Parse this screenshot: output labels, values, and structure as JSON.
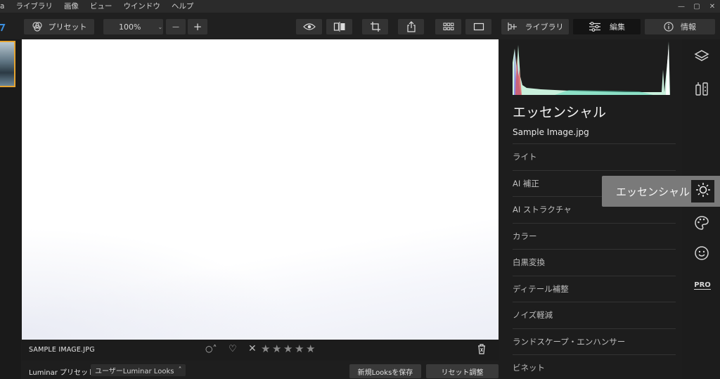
{
  "menubar": {
    "items": [
      "a",
      "ライブラリ",
      "画像",
      "ビュー",
      "ウインドウ",
      "ヘルプ"
    ],
    "window_controls": [
      "—",
      "▢",
      "✕"
    ]
  },
  "toolbar": {
    "preset_label": "プリセット",
    "zoom_value": "100%",
    "zoom_minus": "—",
    "zoom_plus": "+",
    "library_label": "ライブラリ",
    "edit_label": "編集",
    "info_label": "情報"
  },
  "infobar": {
    "filename": "SAMPLE IMAGE.JPG",
    "flag": "○˄",
    "heart": "♡",
    "reject": "✕",
    "stars": [
      "★",
      "★",
      "★",
      "★",
      "★"
    ],
    "rating": 0
  },
  "presetbar": {
    "label": "Luminar プリセット",
    "dropdown": "ユーザーLuminar Looks",
    "dropdown_arrow": "˄",
    "save_looks": "新規Looksを保存",
    "reset": "リセット調整"
  },
  "panel": {
    "title": "エッセンシャル",
    "filename": "Sample Image.jpg",
    "sections": [
      "ライト",
      "AI 補正",
      "AI ストラクチャ",
      "カラー",
      "白黒変換",
      "ディテール補整",
      "ノイズ軽減",
      "ランドスケープ・エンハンサー",
      "ビネット"
    ]
  },
  "rail": {
    "pro_label": "PRO"
  },
  "tooltip": {
    "label": "エッセンシャル"
  },
  "colors": {
    "accent": "#e5a431",
    "panel_bg": "#1d1d1d",
    "tooltip_bg": "#7a7a7a"
  }
}
